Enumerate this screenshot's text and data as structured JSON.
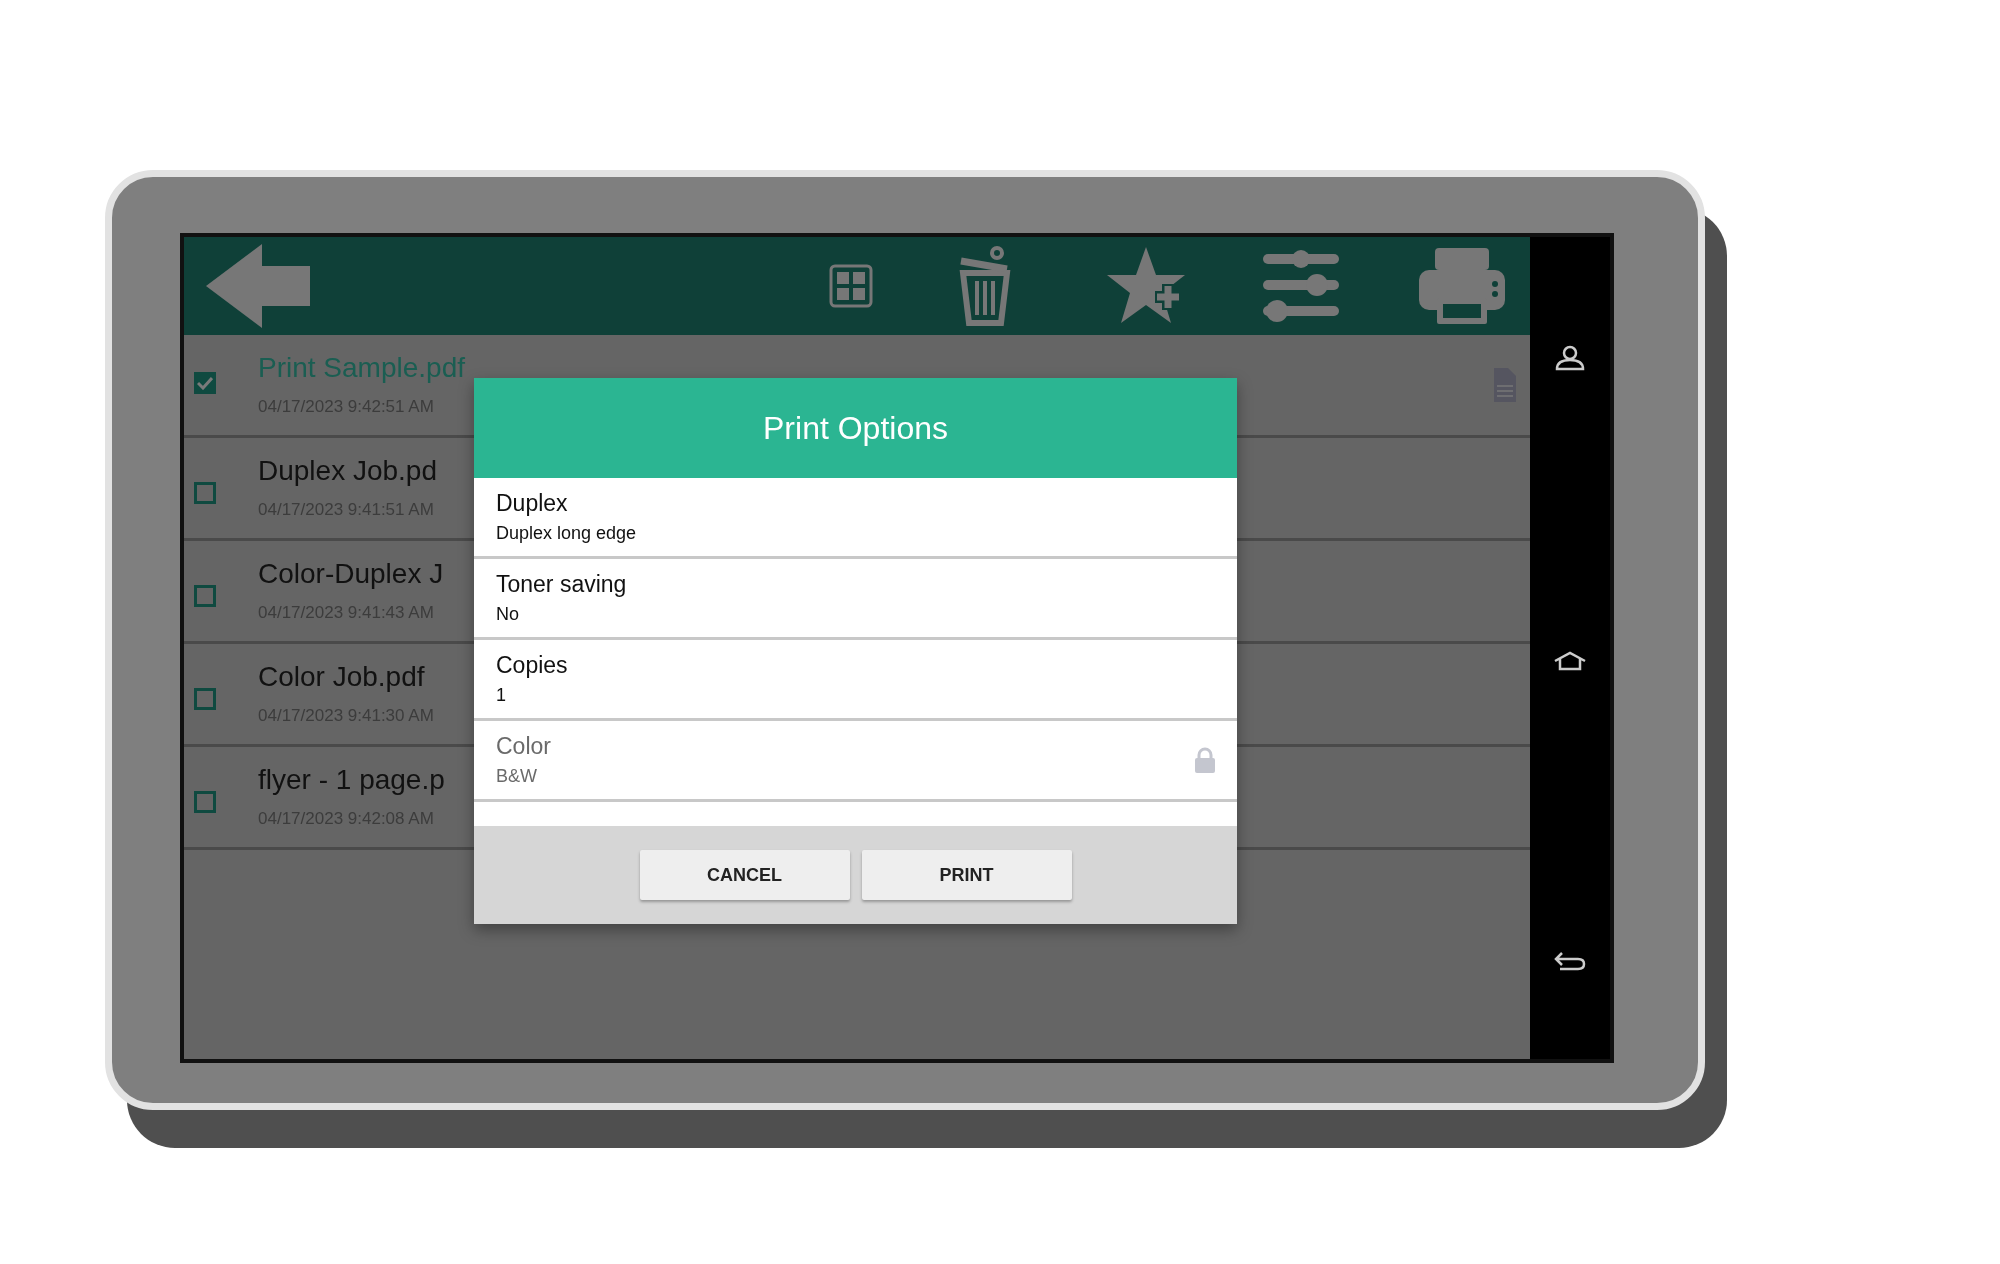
{
  "jobs": [
    {
      "name": "Print Sample.pdf",
      "date": "04/17/2023 9:42:51 AM",
      "checked": true,
      "file_icon": true
    },
    {
      "name": "Duplex Job.pd",
      "date": "04/17/2023 9:41:51 AM",
      "checked": false,
      "file_icon": false
    },
    {
      "name": "Color-Duplex J",
      "date": "04/17/2023 9:41:43 AM",
      "checked": false,
      "file_icon": false
    },
    {
      "name": "Color Job.pdf",
      "date": "04/17/2023 9:41:30 AM",
      "checked": false,
      "file_icon": false
    },
    {
      "name": "flyer - 1 page.p",
      "date": "04/17/2023 9:42:08 AM",
      "checked": false,
      "file_icon": false
    }
  ],
  "dialog": {
    "title": "Print Options",
    "options": [
      {
        "label": "Duplex",
        "value": "Duplex long edge",
        "locked": false
      },
      {
        "label": "Toner saving",
        "value": "No",
        "locked": false
      },
      {
        "label": "Copies",
        "value": "1",
        "locked": false
      },
      {
        "label": "Color",
        "value": "B&W",
        "locked": true
      }
    ],
    "buttons": [
      "CANCEL",
      "PRINT"
    ]
  }
}
